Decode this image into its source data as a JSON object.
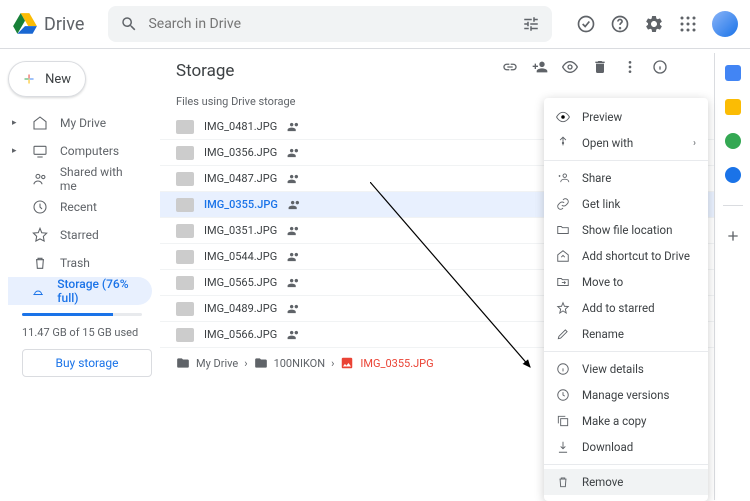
{
  "app": {
    "name": "Drive"
  },
  "search": {
    "placeholder": "Search in Drive"
  },
  "newButton": "New",
  "sidebar": {
    "items": [
      {
        "label": "My Drive",
        "hasChevron": true
      },
      {
        "label": "Computers",
        "hasChevron": true
      },
      {
        "label": "Shared with me"
      },
      {
        "label": "Recent"
      },
      {
        "label": "Starred"
      },
      {
        "label": "Trash"
      },
      {
        "label": "Storage (76% full)",
        "active": true
      }
    ],
    "storageText": "11.47 GB of 15 GB used",
    "buyLabel": "Buy storage"
  },
  "page": {
    "title": "Storage",
    "filesHeader": "Files using Drive storage",
    "files": [
      {
        "name": "IMG_0481.JPG"
      },
      {
        "name": "IMG_0356.JPG"
      },
      {
        "name": "IMG_0487.JPG"
      },
      {
        "name": "IMG_0355.JPG",
        "selected": true
      },
      {
        "name": "IMG_0351.JPG"
      },
      {
        "name": "IMG_0544.JPG"
      },
      {
        "name": "IMG_0565.JPG"
      },
      {
        "name": "IMG_0489.JPG"
      },
      {
        "name": "IMG_0566.JPG"
      }
    ],
    "breadcrumb": [
      "My Drive",
      "100NIKON",
      "IMG_0355.JPG"
    ]
  },
  "contextMenu": {
    "groups": [
      [
        {
          "label": "Preview",
          "icon": "eye"
        },
        {
          "label": "Open with",
          "icon": "open",
          "arrow": true
        }
      ],
      [
        {
          "label": "Share",
          "icon": "person-add"
        },
        {
          "label": "Get link",
          "icon": "link"
        },
        {
          "label": "Show file location",
          "icon": "folder"
        },
        {
          "label": "Add shortcut to Drive",
          "icon": "shortcut"
        },
        {
          "label": "Move to",
          "icon": "move"
        },
        {
          "label": "Add to starred",
          "icon": "star"
        },
        {
          "label": "Rename",
          "icon": "pencil"
        }
      ],
      [
        {
          "label": "View details",
          "icon": "info"
        },
        {
          "label": "Manage versions",
          "icon": "versions"
        },
        {
          "label": "Make a copy",
          "icon": "copy"
        },
        {
          "label": "Download",
          "icon": "download"
        }
      ],
      [
        {
          "label": "Remove",
          "icon": "trash",
          "hover": true
        }
      ]
    ]
  },
  "colors": {
    "accent": "#1a73e8"
  }
}
